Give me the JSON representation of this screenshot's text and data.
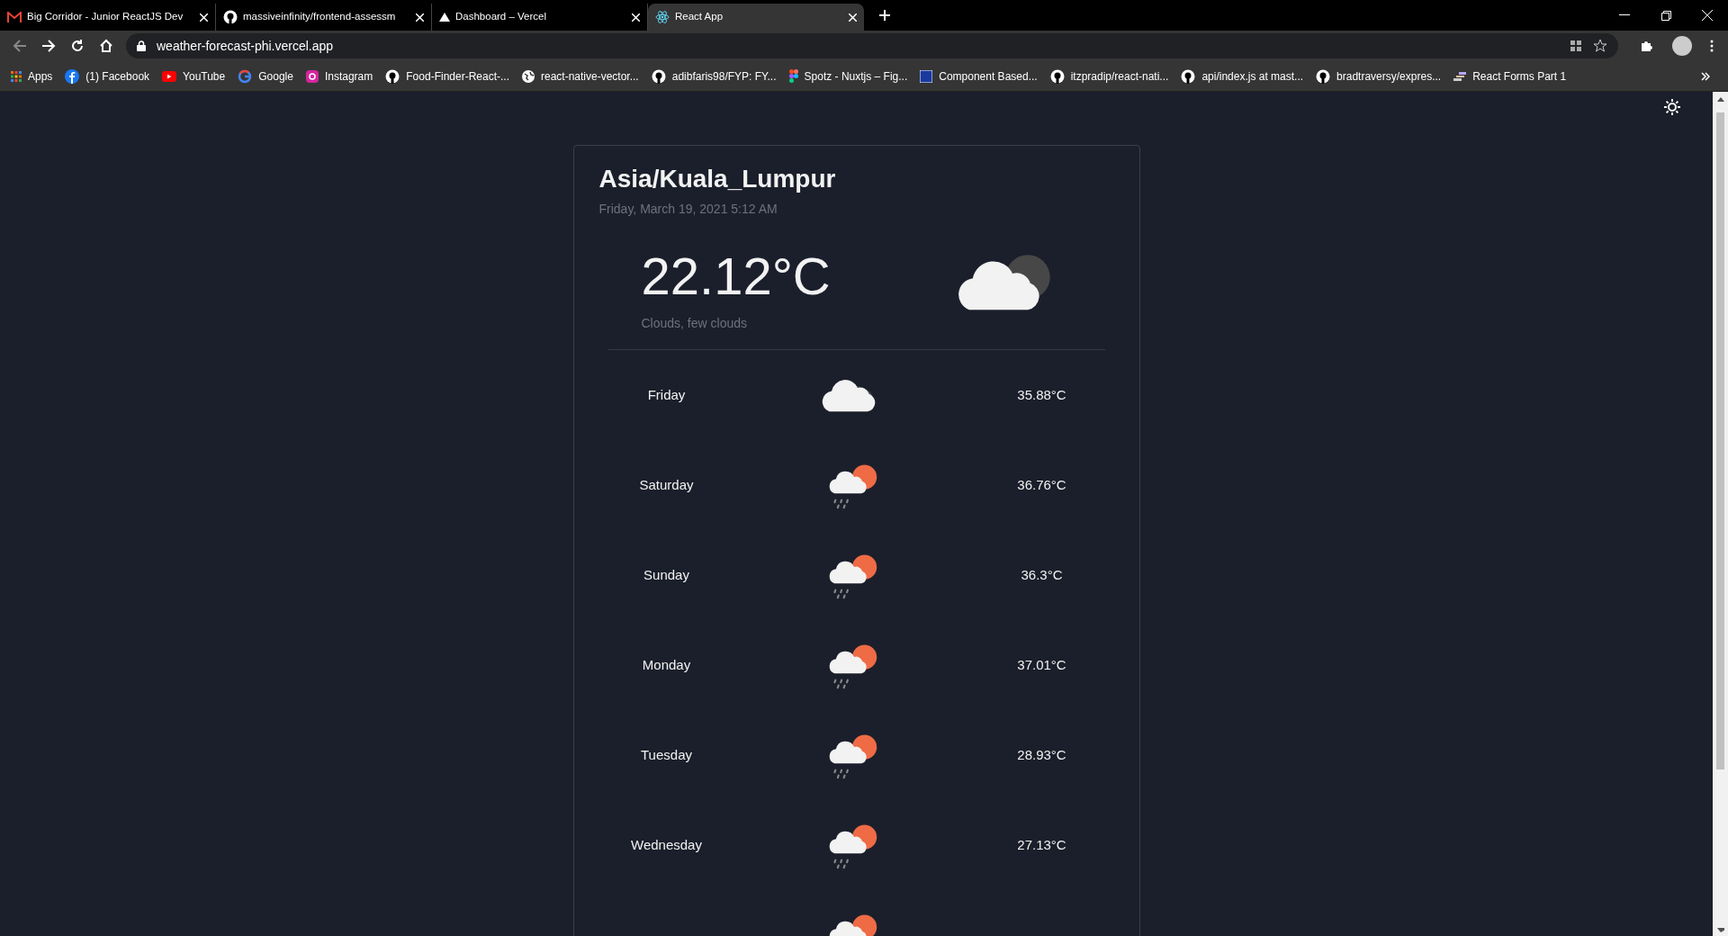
{
  "browser": {
    "tabs": [
      {
        "title": "Big Corridor - Junior ReactJS Dev",
        "selected": false
      },
      {
        "title": "massiveinfinity/frontend-assessm",
        "selected": false
      },
      {
        "title": "Dashboard – Vercel",
        "selected": false
      },
      {
        "title": "React App",
        "selected": true
      }
    ],
    "url": "weather-forecast-phi.vercel.app",
    "bookmarks": [
      "Apps",
      "(1) Facebook",
      "YouTube",
      "Google",
      "Instagram",
      "Food-Finder-React-...",
      "react-native-vector...",
      "adibfaris98/FYP: FY...",
      "Spotz - Nuxtjs – Fig...",
      "Component Based...",
      "itzpradip/react-nati...",
      "api/index.js at mast...",
      "bradtraversy/expres...",
      "React Forms Part 1"
    ]
  },
  "weather": {
    "location": "Asia/Kuala_Lumpur",
    "datetime": "Friday, March 19, 2021 5:12 AM",
    "temperature": "22.12°C",
    "description": "Clouds, few clouds",
    "forecast": [
      {
        "day": "Friday",
        "kind": "clouds",
        "temperature": "35.88°C"
      },
      {
        "day": "Saturday",
        "kind": "rain",
        "temperature": "36.76°C"
      },
      {
        "day": "Sunday",
        "kind": "rain",
        "temperature": "36.3°C"
      },
      {
        "day": "Monday",
        "kind": "rain",
        "temperature": "37.01°C"
      },
      {
        "day": "Tuesday",
        "kind": "rain",
        "temperature": "28.93°C"
      },
      {
        "day": "Wednesday",
        "kind": "rain",
        "temperature": "27.13°C"
      },
      {
        "kind": "rain"
      }
    ]
  }
}
